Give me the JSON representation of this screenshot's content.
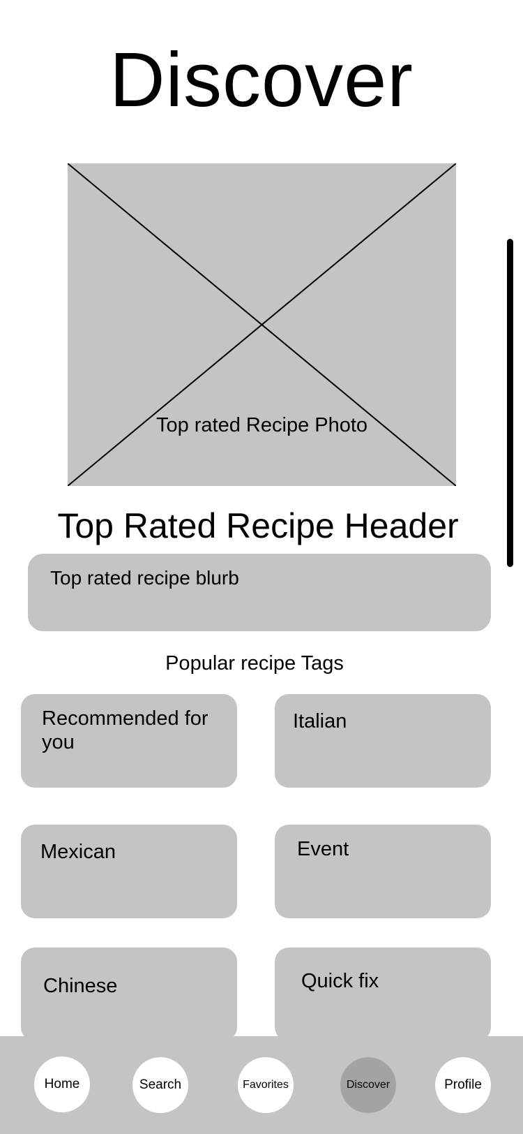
{
  "page": {
    "title": "Discover"
  },
  "hero": {
    "caption": "Top rated Recipe Photo"
  },
  "recipe": {
    "header": "Top Rated Recipe Header",
    "blurb": "Top rated recipe blurb"
  },
  "tags": {
    "heading": "Popular recipe Tags",
    "items": [
      {
        "label": "Recommended for you"
      },
      {
        "label": "Italian"
      },
      {
        "label": "Mexican"
      },
      {
        "label": "Event"
      },
      {
        "label": "Chinese"
      },
      {
        "label": "Quick fix"
      }
    ]
  },
  "nav": {
    "items": [
      {
        "label": "Home"
      },
      {
        "label": "Search"
      },
      {
        "label": "Favorites"
      },
      {
        "label": "Discover",
        "active": true
      },
      {
        "label": "Profile"
      }
    ]
  },
  "colors": {
    "placeholder_gray": "#c4c4c4",
    "active_nav": "#a3a3a3",
    "text": "#000000",
    "background": "#ffffff"
  }
}
